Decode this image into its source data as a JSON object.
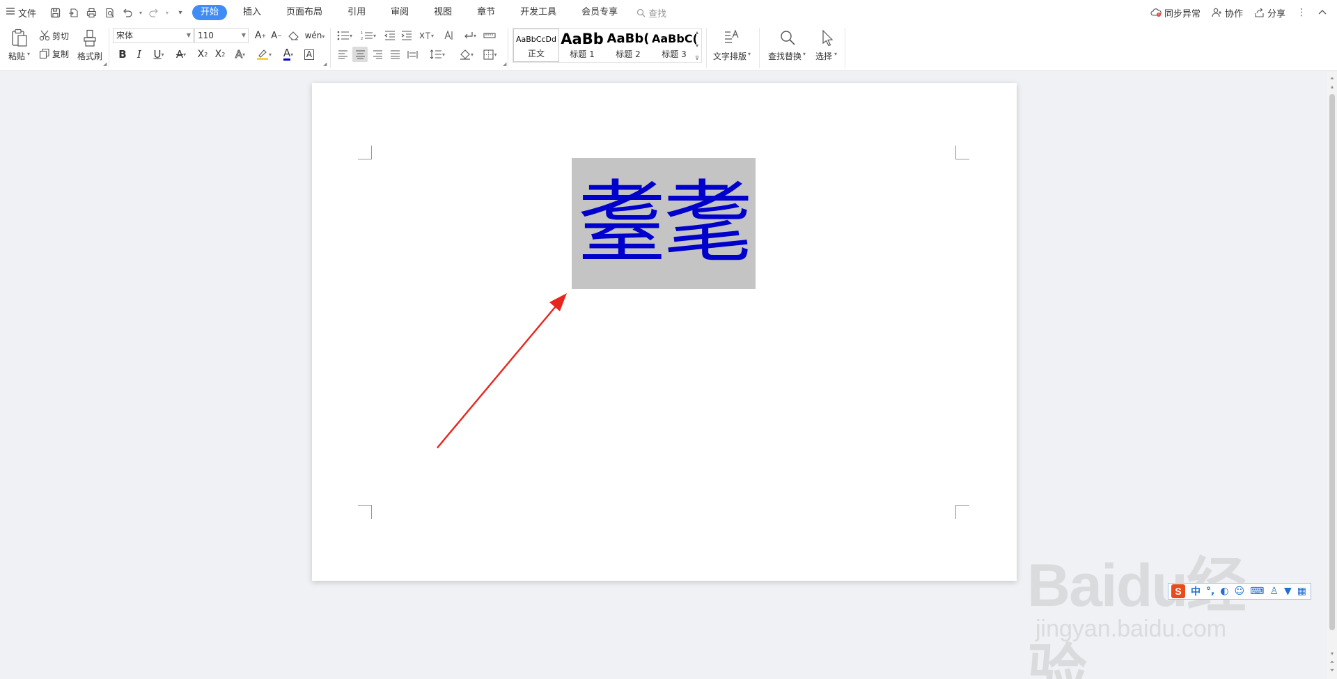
{
  "menubar": {
    "file_label": "文件",
    "tabs": [
      "开始",
      "插入",
      "页面布局",
      "引用",
      "审阅",
      "视图",
      "章节",
      "开发工具",
      "会员专享"
    ],
    "active_tab": "开始",
    "search_label": "查找",
    "sync_label": "同步异常",
    "collab_label": "协作",
    "share_label": "分享"
  },
  "ribbon": {
    "paste_label": "粘贴",
    "cut_label": "剪切",
    "copy_label": "复制",
    "format_painter_label": "格式刷",
    "font_name": "宋体",
    "font_size": "110",
    "styles": [
      {
        "sample": "AaBbCcDd",
        "name": "正文"
      },
      {
        "sample": "AaBb",
        "name": "标题 1"
      },
      {
        "sample": "AaBb(",
        "name": "标题 2"
      },
      {
        "sample": "AaBbC(",
        "name": "标题 3"
      }
    ],
    "text_layout_label": "文字排版",
    "find_replace_label": "查找替换",
    "select_label": "选择"
  },
  "document": {
    "selected_text": "耋耄",
    "text_color": "#0000cc",
    "highlight_color": "#c4c4c4",
    "annotation_arrow_color": "#e8251c"
  },
  "ime": {
    "logo": "S",
    "mode": "中"
  },
  "watermark": {
    "line1": "Baidu经验",
    "line2": "jingyan.baidu.com"
  },
  "colors": {
    "accent": "#3f8cf5",
    "background": "#eff1f4"
  }
}
